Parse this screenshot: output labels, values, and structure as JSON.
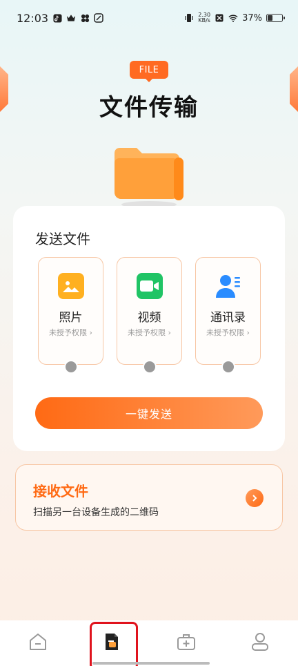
{
  "status_bar": {
    "time": "12:03",
    "net_speed_value": "2.30",
    "net_speed_unit": "KB/s",
    "battery_text": "37%",
    "battery_level": 0.37
  },
  "hero": {
    "badge": "FILE",
    "title": "文件传输"
  },
  "send": {
    "title": "发送文件",
    "options": [
      {
        "label": "照片",
        "status": "未授予权限 ›",
        "icon": "image-icon",
        "color": "#ffb020"
      },
      {
        "label": "视频",
        "status": "未授予权限 ›",
        "icon": "video-icon",
        "color": "#20c465"
      },
      {
        "label": "通讯录",
        "status": "未授予权限 ›",
        "icon": "contacts-icon",
        "color": "#2a8cff"
      }
    ],
    "button_label": "一键发送"
  },
  "receive": {
    "title": "接收文件",
    "subtitle": "扫描另一台设备生成的二维码"
  },
  "nav": {
    "items": [
      {
        "icon": "home-icon",
        "active": false
      },
      {
        "icon": "file-transfer-icon",
        "active": true
      },
      {
        "icon": "toolbox-icon",
        "active": false
      },
      {
        "icon": "user-icon",
        "active": false
      }
    ]
  },
  "colors": {
    "accent": "#ff6a14",
    "highlight_box": "#e0131d"
  }
}
